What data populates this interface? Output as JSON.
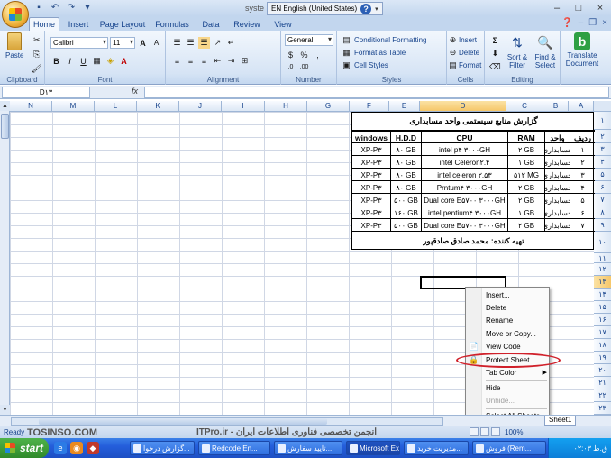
{
  "title": {
    "text": "syste",
    "language_bar": "EN English (United States)"
  },
  "tabs": [
    "Home",
    "Insert",
    "Page Layout",
    "Formulas",
    "Data",
    "Review",
    "View"
  ],
  "ribbon": {
    "clipboard": {
      "label": "Clipboard",
      "paste": "Paste"
    },
    "font": {
      "label": "Font",
      "name": "Calibri",
      "size": "11",
      "bold": "B",
      "italic": "I",
      "underline": "U",
      "grow": "A",
      "shrink": "A"
    },
    "alignment": {
      "label": "Alignment"
    },
    "number": {
      "label": "Number",
      "format": "General",
      "currency": "$",
      "percent": "%",
      "comma": ","
    },
    "styles": {
      "label": "Styles",
      "conditional": "Conditional Formatting",
      "format_table": "Format as Table",
      "cell_styles": "Cell Styles"
    },
    "cells": {
      "label": "Cells",
      "insert": "Insert",
      "delete": "Delete",
      "format": "Format"
    },
    "editing": {
      "label": "Editing",
      "sigma": "Σ",
      "sort_filter": "Sort &",
      "sort_filter2": "Filter",
      "find_select": "Find &",
      "find_select2": "Select"
    },
    "translate": {
      "label": "Translate",
      "label2": "Document"
    }
  },
  "formula_bar": {
    "name_box": "D۱۳",
    "fx": "fx",
    "value": ""
  },
  "columns": [
    "N",
    "M",
    "L",
    "K",
    "J",
    "I",
    "H",
    "G",
    "F",
    "E",
    "D",
    "C",
    "B",
    "A"
  ],
  "rows": [
    "۱",
    "۲",
    "۳",
    "۴",
    "۵",
    "۶",
    "۷",
    "۸",
    "۹",
    "۱۰",
    "۱۱",
    "۱۲",
    "۱۳",
    "۱۴",
    "۱۵",
    "۱۶",
    "۱۷",
    "۱۸",
    "۱۹",
    "۲۰",
    "۲۱",
    "۲۲",
    "۲۳",
    "۲۴"
  ],
  "report": {
    "title": "گزارش منابع سیستمی واحد مسابداری",
    "headers": [
      "windows",
      "H.D.D",
      "CPU",
      "RAM",
      "واحد",
      "ردیف"
    ],
    "rows": [
      [
        "XP-P۳",
        "۸۰ GB",
        "intel p۴ ۳۰۰۰GH",
        "۲ GB",
        "حسابداری",
        "۱"
      ],
      [
        "XP-P۳",
        "۸۰ GB",
        "intel Celeron۲.۴",
        "۱ GB",
        "حسابداری",
        "۲"
      ],
      [
        "XP-P۳",
        "۸۰ GB",
        "intel celeron ۲.۵۳",
        "۵۱۲ MG",
        "حسابداری",
        "۳"
      ],
      [
        "XP-P۳",
        "۸۰ GB",
        "Prntum۴ ۳۰۰۰GH",
        "۲ GB",
        "حسابداری",
        "۴"
      ],
      [
        "XP-P۳",
        "۵۰۰ GB",
        "Dual core E۵۷۰۰ ۳۰۰۰GH",
        "۲ GB",
        "حسابداری",
        "۵"
      ],
      [
        "XP-P۳",
        "۱۶۰ GB",
        "intel pentium۴ ۳۰۰۰GH",
        "۱ GB",
        "حسابداری",
        "۶"
      ],
      [
        "XP-P۳",
        "۵۰۰ GB",
        "Dual core E۵۷۰۰ ۳۰۰۰GH",
        "۲ GB",
        "حسابداری",
        "۷"
      ]
    ],
    "prepared_by": "تهیه کننده:  محمد صادق صادقپور"
  },
  "context_menu": {
    "items": [
      "Insert...",
      "Delete",
      "Rename",
      "Move or Copy...",
      "View Code",
      "Protect Sheet...",
      "Tab Color",
      "Hide",
      "Unhide...",
      "Select All Sheets"
    ],
    "highlighted": "Protect Sheet...",
    "disabled": "Unhide..."
  },
  "sheet_tab": "Sheet1",
  "status": {
    "ready": "Ready",
    "zoom": "100%"
  },
  "watermarks": {
    "left": "TOSINSO.COM",
    "right": "ITPro.ir - انجمن تخصصی فناوری اطلاعات ایران"
  },
  "taskbar": {
    "start": "start",
    "tasks": [
      "گزارش درخوا...",
      "Redcode En...",
      "تایید سفارش...",
      "Microsoft Ex...",
      "مدیریت خرید...",
      "فروش (Rem..."
    ],
    "active": "Microsoft Ex...",
    "clock": "۰۲:۰۳ ق.ظ"
  },
  "colors": {
    "accent": "#15428b",
    "ribbon": "#d6e4f5",
    "highlight_oval": "#d0202a"
  }
}
